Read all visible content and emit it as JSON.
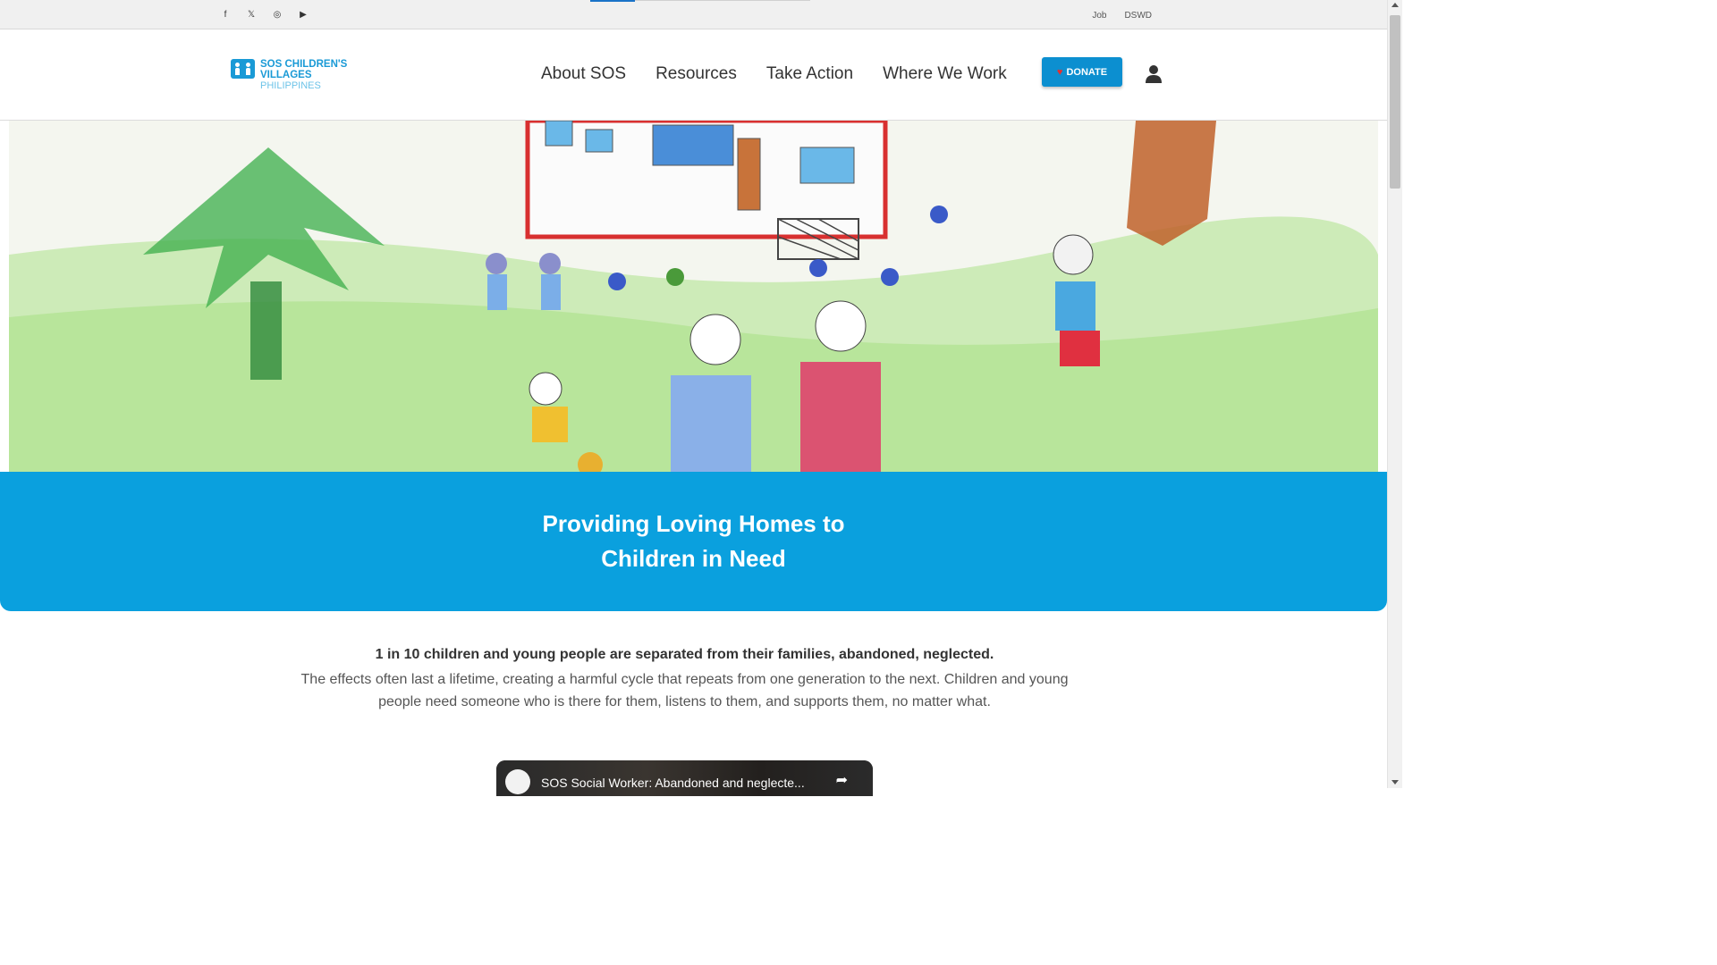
{
  "topbar": {
    "social": [
      {
        "name": "facebook-icon",
        "glyph": "f"
      },
      {
        "name": "x-icon",
        "glyph": "𝕏"
      },
      {
        "name": "instagram-icon",
        "glyph": "◎"
      },
      {
        "name": "youtube-icon",
        "glyph": "▶"
      }
    ],
    "links": [
      "Job",
      "DSWD"
    ]
  },
  "logo": {
    "line1": "SOS CHILDREN'S",
    "line2": "VILLAGES",
    "line3": "PHILIPPINES"
  },
  "nav": {
    "items": [
      "About SOS",
      "Resources",
      "Take Action",
      "Where We Work"
    ],
    "donate_label": "DONATE"
  },
  "banner": {
    "heading": "Providing Loving Homes to Children in Need"
  },
  "intro": {
    "lead": "1 in 10 children and young people are separated from their families, abandoned, neglected.",
    "body": "The effects often last a lifetime, creating a harmful cycle that repeats from one generation to the next. Children and young people need someone who is there for them, listens to them, and supports them, no matter what."
  },
  "video": {
    "title": "SOS Social Worker: Abandoned and neglecte..."
  },
  "colors": {
    "brand_blue": "#0aa0de",
    "donate_blue": "#0c8fd0",
    "heart_red": "#e53030"
  }
}
